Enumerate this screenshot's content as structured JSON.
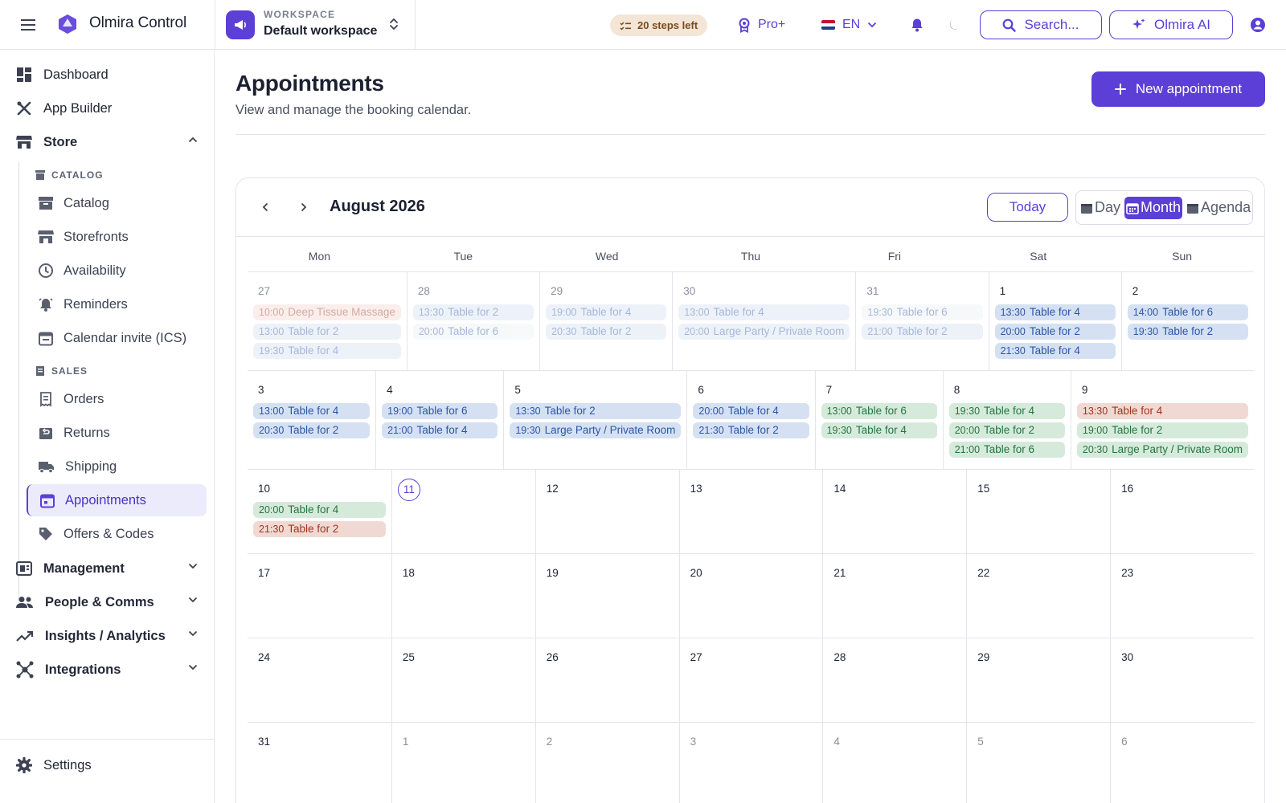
{
  "topbar": {
    "app_title": "Olmira Control",
    "workspace_kicker": "WORKSPACE",
    "workspace_name": "Default workspace",
    "steps_left": "20 steps left",
    "plan": "Pro+",
    "language": "EN",
    "search_label": "Search...",
    "ai_label": "Olmira AI"
  },
  "sidebar": {
    "dashboard": "Dashboard",
    "app_builder": "App Builder",
    "store": "Store",
    "catalog_section": "CATALOG",
    "catalog_items": [
      "Catalog",
      "Storefronts",
      "Availability",
      "Reminders",
      "Calendar invite (ICS)"
    ],
    "sales_section": "SALES",
    "sales_items": [
      "Orders",
      "Returns",
      "Shipping",
      "Appointments",
      "Offers & Codes"
    ],
    "active_item": "Appointments",
    "groups": [
      "Management",
      "People & Comms",
      "Insights / Analytics",
      "Integrations"
    ],
    "settings": "Settings"
  },
  "page": {
    "title": "Appointments",
    "subtitle": "View and manage the booking calendar.",
    "new_button": "New appointment"
  },
  "calendar": {
    "month_label": "August 2026",
    "today_label": "Today",
    "views": [
      "Day",
      "Month",
      "Agenda"
    ],
    "active_view": "Month",
    "weekdays": [
      "Mon",
      "Tue",
      "Wed",
      "Thu",
      "Fri",
      "Sat",
      "Sun"
    ],
    "weeks": [
      [
        {
          "day": "27",
          "other": true,
          "events": [
            {
              "time": "10:00",
              "title": "Deep Tissue Massage",
              "color": "red"
            },
            {
              "time": "13:00",
              "title": "Table for 2",
              "color": "blue"
            },
            {
              "time": "19:30",
              "title": "Table for 4",
              "color": "blue"
            }
          ]
        },
        {
          "day": "28",
          "other": true,
          "events": [
            {
              "time": "13:30",
              "title": "Table for 2",
              "color": "blue"
            },
            {
              "time": "20:00",
              "title": "Table for 6",
              "color": "white"
            }
          ]
        },
        {
          "day": "29",
          "other": true,
          "events": [
            {
              "time": "19:00",
              "title": "Table for 4",
              "color": "blue"
            },
            {
              "time": "20:30",
              "title": "Table for 2",
              "color": "blue"
            }
          ]
        },
        {
          "day": "30",
          "other": true,
          "events": [
            {
              "time": "13:00",
              "title": "Table for 4",
              "color": "blue"
            },
            {
              "time": "20:00",
              "title": "Large Party / Private Room",
              "color": "blue"
            }
          ]
        },
        {
          "day": "31",
          "other": true,
          "events": [
            {
              "time": "19:30",
              "title": "Table for 6",
              "color": "white"
            },
            {
              "time": "21:00",
              "title": "Table for 2",
              "color": "blue"
            }
          ]
        },
        {
          "day": "1",
          "other": false,
          "events": [
            {
              "time": "13:30",
              "title": "Table for 4",
              "color": "blue"
            },
            {
              "time": "20:00",
              "title": "Table for 2",
              "color": "blue"
            },
            {
              "time": "21:30",
              "title": "Table for 4",
              "color": "blue"
            }
          ]
        },
        {
          "day": "2",
          "other": false,
          "events": [
            {
              "time": "14:00",
              "title": "Table for 6",
              "color": "blue"
            },
            {
              "time": "19:30",
              "title": "Table for 2",
              "color": "blue"
            }
          ]
        }
      ],
      [
        {
          "day": "3",
          "events": [
            {
              "time": "13:00",
              "title": "Table for 4",
              "color": "blue"
            },
            {
              "time": "20:30",
              "title": "Table for 2",
              "color": "blue"
            }
          ]
        },
        {
          "day": "4",
          "events": [
            {
              "time": "19:00",
              "title": "Table for 6",
              "color": "blue"
            },
            {
              "time": "21:00",
              "title": "Table for 4",
              "color": "blue"
            }
          ]
        },
        {
          "day": "5",
          "events": [
            {
              "time": "13:30",
              "title": "Table for 2",
              "color": "blue"
            },
            {
              "time": "19:30",
              "title": "Large Party / Private Room",
              "color": "blue"
            }
          ]
        },
        {
          "day": "6",
          "events": [
            {
              "time": "20:00",
              "title": "Table for 4",
              "color": "blue"
            },
            {
              "time": "21:30",
              "title": "Table for 2",
              "color": "blue"
            }
          ]
        },
        {
          "day": "7",
          "events": [
            {
              "time": "13:00",
              "title": "Table for 6",
              "color": "green"
            },
            {
              "time": "19:30",
              "title": "Table for 4",
              "color": "green"
            }
          ]
        },
        {
          "day": "8",
          "events": [
            {
              "time": "19:30",
              "title": "Table for 4",
              "color": "green"
            },
            {
              "time": "20:00",
              "title": "Table for 2",
              "color": "green"
            },
            {
              "time": "21:00",
              "title": "Table for 6",
              "color": "green"
            }
          ]
        },
        {
          "day": "9",
          "events": [
            {
              "time": "13:30",
              "title": "Table for 4",
              "color": "red"
            },
            {
              "time": "19:00",
              "title": "Table for 2",
              "color": "green"
            },
            {
              "time": "20:30",
              "title": "Large Party / Private Room",
              "color": "green"
            }
          ]
        }
      ],
      [
        {
          "day": "10",
          "events": [
            {
              "time": "20:00",
              "title": "Table for 4",
              "color": "green"
            },
            {
              "time": "21:30",
              "title": "Table for 2",
              "color": "red"
            }
          ]
        },
        {
          "day": "11",
          "today": true,
          "events": []
        },
        {
          "day": "12",
          "events": []
        },
        {
          "day": "13",
          "events": []
        },
        {
          "day": "14",
          "events": []
        },
        {
          "day": "15",
          "events": []
        },
        {
          "day": "16",
          "events": []
        }
      ],
      [
        {
          "day": "17",
          "events": []
        },
        {
          "day": "18",
          "events": []
        },
        {
          "day": "19",
          "events": []
        },
        {
          "day": "20",
          "events": []
        },
        {
          "day": "21",
          "events": []
        },
        {
          "day": "22",
          "events": []
        },
        {
          "day": "23",
          "events": []
        }
      ],
      [
        {
          "day": "24",
          "events": []
        },
        {
          "day": "25",
          "events": []
        },
        {
          "day": "26",
          "events": []
        },
        {
          "day": "27",
          "events": []
        },
        {
          "day": "28",
          "events": []
        },
        {
          "day": "29",
          "events": []
        },
        {
          "day": "30",
          "events": []
        }
      ],
      [
        {
          "day": "31",
          "events": []
        },
        {
          "day": "1",
          "other": true,
          "events": []
        },
        {
          "day": "2",
          "other": true,
          "events": []
        },
        {
          "day": "3",
          "other": true,
          "events": []
        },
        {
          "day": "4",
          "other": true,
          "events": []
        },
        {
          "day": "5",
          "other": true,
          "events": []
        },
        {
          "day": "6",
          "other": true,
          "events": []
        }
      ]
    ]
  },
  "colors": {
    "accent": "#5b3fd6",
    "event_blue": "#d5e1f3",
    "event_green": "#d6eadc",
    "event_red": "#f1d9d3"
  }
}
